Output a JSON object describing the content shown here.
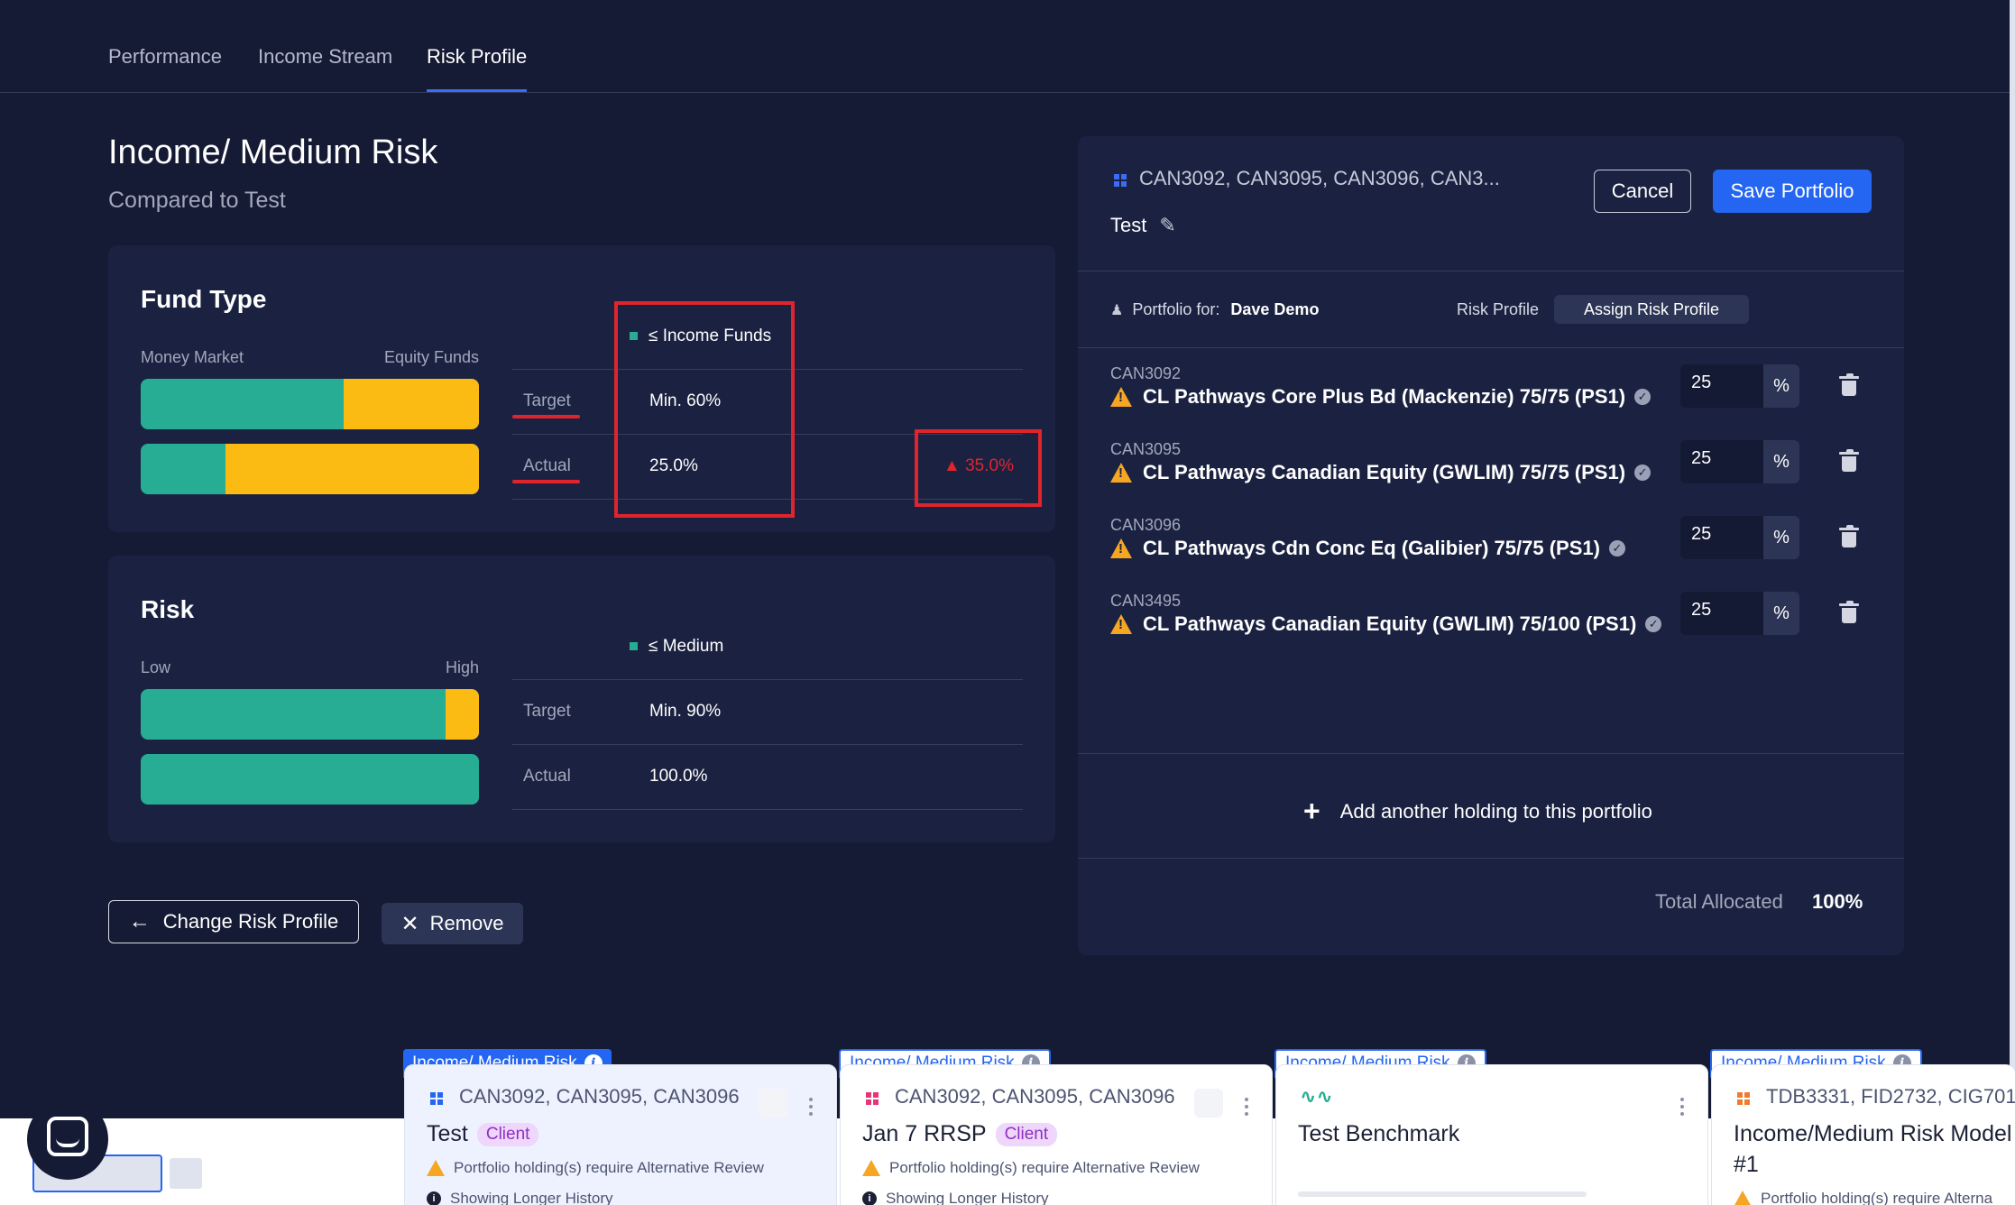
{
  "tabs": [
    {
      "label": "Performance",
      "active": false
    },
    {
      "label": "Income Stream",
      "active": false
    },
    {
      "label": "Risk Profile",
      "active": true
    }
  ],
  "header": {
    "title": "Income/ Medium Risk",
    "subtitle": "Compared to Test"
  },
  "fund_type": {
    "title": "Fund Type",
    "left_label": "Money Market",
    "right_label": "Equity Funds",
    "target_bar_teal_fraction": 0.6,
    "actual_bar_teal_fraction": 0.25,
    "legend": "≤ Income Funds",
    "rows": [
      {
        "label": "Target",
        "value": "Min. 60%",
        "diff": ""
      },
      {
        "label": "Actual",
        "value": "25.0%",
        "diff": "▲ 35.0%"
      }
    ]
  },
  "risk": {
    "title": "Risk",
    "left_label": "Low",
    "right_label": "High",
    "target_bar_teal_fraction": 0.9,
    "actual_bar_teal_fraction": 1.0,
    "legend": "≤ Medium",
    "rows": [
      {
        "label": "Target",
        "value": "Min. 90%"
      },
      {
        "label": "Actual",
        "value": "100.0%"
      }
    ]
  },
  "actions": {
    "change_risk_profile": "Change Risk Profile",
    "remove": "Remove"
  },
  "portfolio": {
    "codes": "CAN3092, CAN3095, CAN3096, CAN3...",
    "name": "Test",
    "cancel": "Cancel",
    "save": "Save Portfolio",
    "portfolio_for_label": "Portfolio for:",
    "portfolio_for_value": "Dave Demo",
    "risk_profile_label": "Risk Profile",
    "assign_risk_profile": "Assign Risk Profile",
    "holdings": [
      {
        "code": "CAN3092",
        "name": "CL Pathways Core Plus Bd (Mackenzie) 75/75 (PS1)",
        "pct": "25"
      },
      {
        "code": "CAN3095",
        "name": "CL Pathways Canadian Equity (GWLIM) 75/75 (PS1)",
        "pct": "25"
      },
      {
        "code": "CAN3096",
        "name": "CL Pathways Cdn Conc Eq (Galibier) 75/75 (PS1)",
        "pct": "25"
      },
      {
        "code": "CAN3495",
        "name": "CL Pathways Canadian Equity (GWLIM) 75/100 (PS1)",
        "pct": "25"
      }
    ],
    "pct_suffix": "%",
    "add_holding": "Add another holding to this portfolio",
    "total_label": "Total Allocated",
    "total_value": "100%"
  },
  "cards": [
    {
      "tag": "Income/ Medium Risk",
      "codes": "CAN3092, CAN3095, CAN3096",
      "title": "Test",
      "pill": "Client",
      "note1": "Portfolio holding(s) require Alternative Review",
      "note2": "Showing Longer History"
    },
    {
      "tag": "Income/ Medium Risk",
      "codes": "CAN3092, CAN3095, CAN3096",
      "title": "Jan 7 RRSP",
      "pill": "Client",
      "note1": "Portfolio holding(s) require Alternative Review",
      "note2": "Showing Longer History"
    },
    {
      "tag": "Income/ Medium Risk",
      "codes": "",
      "title": "Test Benchmark",
      "pill": "",
      "note1": "",
      "note2": ""
    },
    {
      "tag": "Income/ Medium Risk",
      "codes": "TDB3331, FID2732, CIG701",
      "title": "Income/Medium Risk Model",
      "title2": "#1",
      "pill": "",
      "note1": "Portfolio holding(s) require Alterna",
      "note2": ""
    }
  ],
  "colors": {
    "background": "#151b35",
    "panel": "#1b2241",
    "teal": "#26ad93",
    "yellow": "#fbbb13",
    "accent_blue": "#2466f2",
    "highlight_red": "#e0242d"
  }
}
